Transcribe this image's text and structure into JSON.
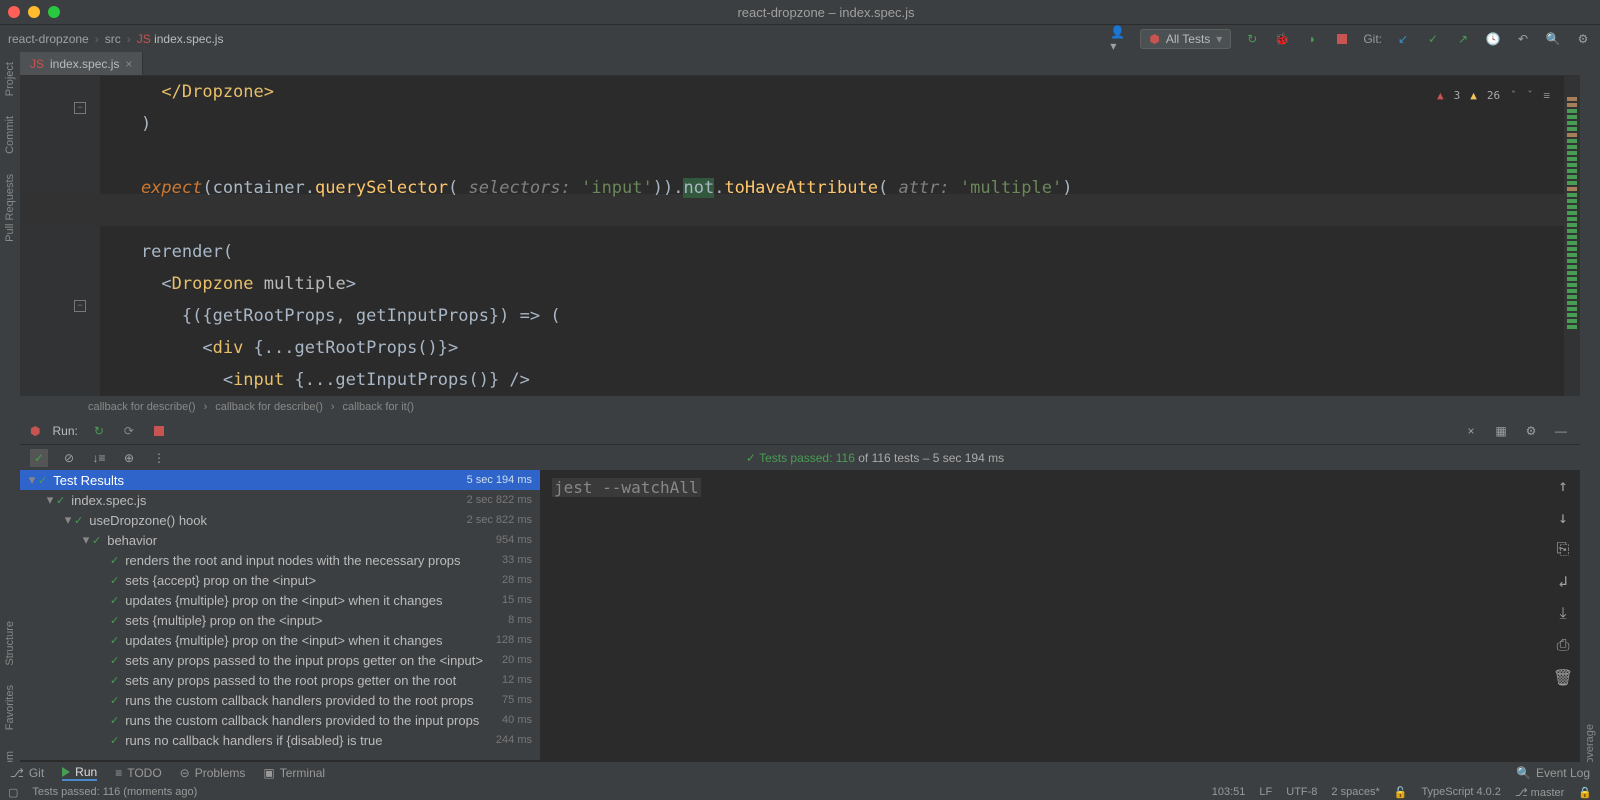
{
  "window": {
    "title": "react-dropzone – index.spec.js"
  },
  "breadcrumbs": {
    "project": "react-dropzone",
    "folder": "src",
    "file": "index.spec.js"
  },
  "toolbar": {
    "run_config": "All Tests",
    "git_label": "Git:"
  },
  "tab": {
    "name": "index.spec.js"
  },
  "rails": {
    "project": "Project",
    "commit": "Commit",
    "pull_requests": "Pull Requests",
    "structure": "Structure",
    "favorites": "Favorites",
    "npm": "npm",
    "coverage": "Coverage"
  },
  "warnings": {
    "errors": "3",
    "warns": "26"
  },
  "code": {
    "l1": "      </Dropzone>",
    "l2": "    )",
    "l3": "",
    "l4_pre": "    expect",
    "l4_q": "(container.",
    "l4_m": "querySelector",
    "l4_p1": "(",
    "l4_hint1": " selectors: ",
    "l4_s1": "'input'",
    "l4_mid": ")).",
    "l4_not": "not",
    "l4_dot": ".",
    "l4_m2": "toHaveAttribute",
    "l4_p2": "(",
    "l4_hint2": " attr: ",
    "l4_s2": "'multiple'",
    "l4_end": ")",
    "l5": "",
    "l6": "    rerender(",
    "l7_a": "      <",
    "l7_t": "Dropzone",
    "l7_sp": " ",
    "l7_attr": "multiple",
    "l7_b": ">",
    "l8": "        {({getRootProps, getInputProps}) => (",
    "l9_a": "          <",
    "l9_t": "div",
    "l9_b": " {...getRootProps()}>",
    "l10_a": "            <",
    "l10_t": "input",
    "l10_b": " {...getInputProps()} />"
  },
  "editor_crumbs": {
    "c1": "callback for describe()",
    "c2": "callback for describe()",
    "c3": "callback for it()"
  },
  "run": {
    "label": "Run:",
    "summary_pass": "Tests passed: 116",
    "summary_rest": " of 116 tests – 5 sec 194 ms",
    "console": "jest --watchAll"
  },
  "tests": [
    {
      "depth": 0,
      "exp": "v",
      "name": "Test Results",
      "time": "5 sec 194 ms",
      "sel": true
    },
    {
      "depth": 1,
      "exp": "v",
      "name": "index.spec.js",
      "time": "2 sec 822 ms"
    },
    {
      "depth": 2,
      "exp": "v",
      "name": "useDropzone() hook",
      "time": "2 sec 822 ms"
    },
    {
      "depth": 3,
      "exp": "v",
      "name": "behavior",
      "time": "954 ms"
    },
    {
      "depth": 4,
      "name": "renders the root and input nodes with the necessary props",
      "time": "33 ms"
    },
    {
      "depth": 4,
      "name": "sets {accept} prop on the <input>",
      "time": "28 ms"
    },
    {
      "depth": 4,
      "name": "updates {multiple} prop on the <input> when it changes",
      "time": "15 ms"
    },
    {
      "depth": 4,
      "name": "sets {multiple} prop on the <input>",
      "time": "8 ms"
    },
    {
      "depth": 4,
      "name": "updates {multiple} prop on the <input> when it changes",
      "time": "128 ms"
    },
    {
      "depth": 4,
      "name": "sets any props passed to the input props getter on the <input>",
      "time": "20 ms"
    },
    {
      "depth": 4,
      "name": "sets any props passed to the root props getter on the root",
      "time": "12 ms"
    },
    {
      "depth": 4,
      "name": "runs the custom callback handlers provided to the root props",
      "time": "75 ms"
    },
    {
      "depth": 4,
      "name": "runs the custom callback handlers provided to the input props",
      "time": "40 ms"
    },
    {
      "depth": 4,
      "name": "runs no callback handlers if {disabled} is true",
      "time": "244 ms"
    }
  ],
  "bottom": {
    "git": "Git",
    "run": "Run",
    "todo": "TODO",
    "problems": "Problems",
    "terminal": "Terminal",
    "event_log": "Event Log"
  },
  "status": {
    "msg": "Tests passed: 116 (moments ago)",
    "pos": "103:51",
    "sep": "LF",
    "enc": "UTF-8",
    "indent": "2 spaces*",
    "ts": "TypeScript 4.0.2",
    "branch": "master"
  }
}
